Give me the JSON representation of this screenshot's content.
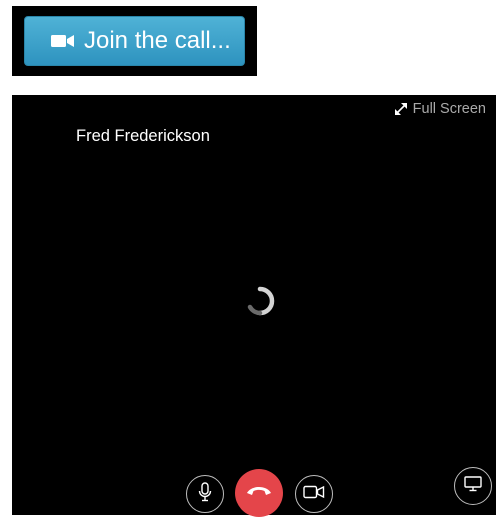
{
  "join": {
    "label": "Join the call...",
    "icon": "video-camera-icon",
    "color": "#3aa2cb"
  },
  "video": {
    "fullscreen_label": "Full Screen",
    "fullscreen_icon": "expand-arrows-icon",
    "participant_name": "Fred Frederickson",
    "status": "loading",
    "background": "#000000"
  },
  "controls": {
    "mic_icon": "microphone-icon",
    "hangup_icon": "hang-up-phone-icon",
    "hangup_color": "#e4454a",
    "camera_icon": "camera-icon",
    "share_icon": "screen-share-icon"
  }
}
